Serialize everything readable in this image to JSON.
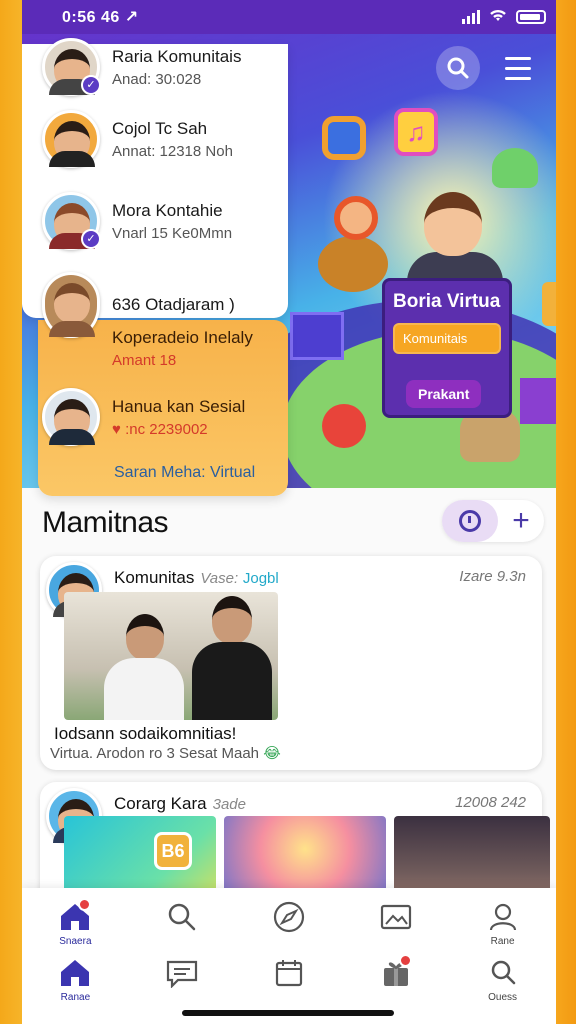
{
  "status_bar": {
    "time": "0:56 46 ↗"
  },
  "hero": {
    "brand_title": "Boria Virtua",
    "brand_button_1": "Komunitais",
    "brand_button_2": "Prakant"
  },
  "friends": [
    {
      "name": "Raria Komunitais",
      "sub": "Anad: 30:028",
      "verified": true
    },
    {
      "name": "Cojol Tc Sah",
      "sub": "Annat: 12318 Noh",
      "verified": false,
      "emoji": true
    },
    {
      "name": "Mora Kontahie",
      "sub": "Vnarl 15 Ke0Mmn",
      "verified": true,
      "emoji": true
    },
    {
      "name": "636 Otadjaram )",
      "sub": "",
      "verified": false
    },
    {
      "name": "Koperadeio Inelaly",
      "sub": "Amant 18",
      "verified": false
    },
    {
      "name": "Hanua kan Sesial",
      "sub": "♥ :nc 2239002",
      "verified": false
    }
  ],
  "friends_footer": "Saran Meha: Virtual",
  "section": {
    "title": "Mamitnas"
  },
  "posts": [
    {
      "name": "Komunitas",
      "tag": "Vase:",
      "tag2": "Jogbl",
      "time": "Izare 9.3n",
      "caption1": "Iodsann sodaikomnitias!",
      "caption2": "Virtua. Arodon ro 3 Sesat Maah",
      "caption_emoji": "😂"
    },
    {
      "name": "Corarg Kara",
      "tag": "3ade",
      "time": "12008 242",
      "photo_app_label": "B6"
    }
  ],
  "bottom_nav": {
    "row1": [
      {
        "icon": "home-icon",
        "label": "Snaera",
        "badge": true,
        "active": true
      },
      {
        "icon": "search-icon",
        "label": "",
        "badge": false
      },
      {
        "icon": "compass-icon",
        "label": "",
        "badge": false
      },
      {
        "icon": "gallery-icon",
        "label": "",
        "badge": false
      },
      {
        "icon": "profile-icon",
        "label": "Rane",
        "badge": false
      }
    ],
    "row2": [
      {
        "icon": "home-icon",
        "label": "Ranae",
        "badge": false,
        "active": true
      },
      {
        "icon": "chat-icon",
        "label": "",
        "badge": false
      },
      {
        "icon": "calendar-icon",
        "label": "",
        "badge": false
      },
      {
        "icon": "gift-icon",
        "label": "",
        "badge": true
      },
      {
        "icon": "search-icon",
        "label": "Ouess",
        "badge": false
      }
    ]
  },
  "colors": {
    "accent": "#5b2bb8",
    "orange_panel": "#f7b24a",
    "nav_active": "#3b35b0"
  }
}
